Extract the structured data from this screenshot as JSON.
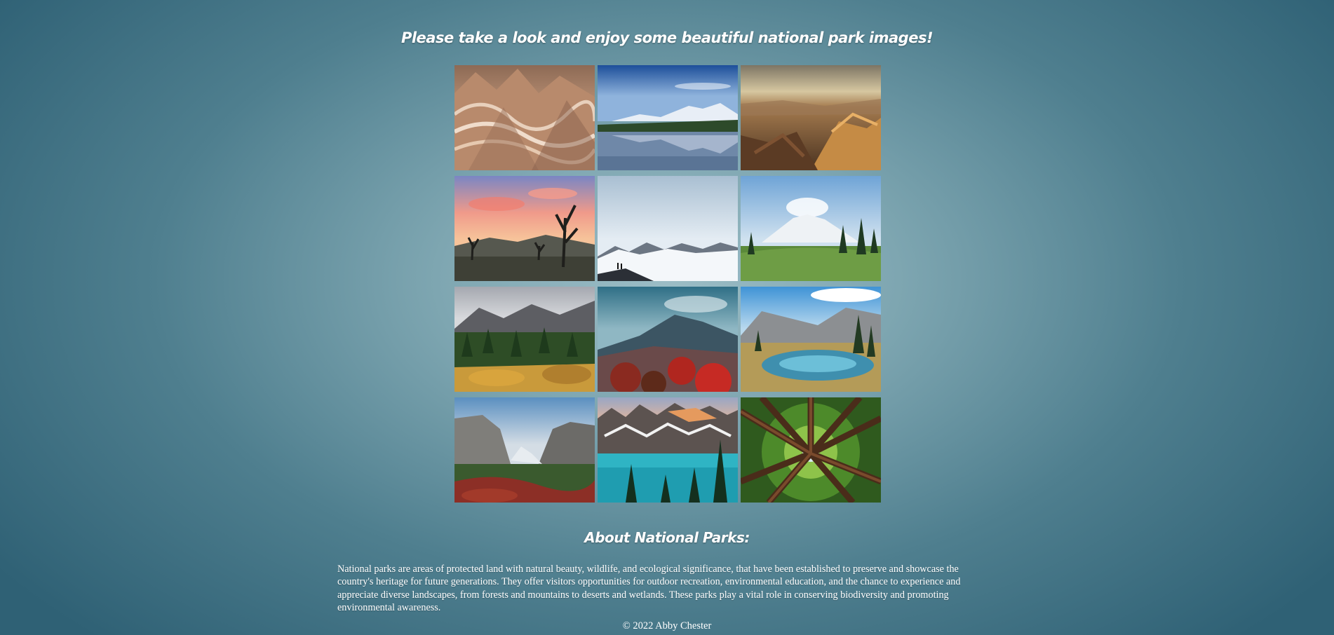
{
  "page": {
    "heading": "Please take a look and enjoy some beautiful national park images!",
    "about_title": "About National Parks:",
    "about_text": "National parks are areas of protected land with natural beauty, wildlife, and ecological significance, that have been established to preserve and showcase the country's heritage for future generations. They offer visitors opportunities for outdoor recreation, environmental education, and the chance to experience and appreciate diverse landscapes, from forests and mountains to deserts and wetlands. These parks play a vital role in conserving biodiversity and promoting environmental awareness.",
    "footer": "© 2022 Abby Chester"
  },
  "colors": {
    "background_center": "#9cbdc6",
    "background_edge": "#2f6175",
    "text": "#ffffff"
  },
  "gallery": {
    "images": [
      {
        "icon": "badlands-photo"
      },
      {
        "icon": "mountain-lake-photo"
      },
      {
        "icon": "grand-canyon-photo"
      },
      {
        "icon": "joshua-tree-photo"
      },
      {
        "icon": "snowfield-photo"
      },
      {
        "icon": "mount-rainier-photo"
      },
      {
        "icon": "autumn-valley-photo"
      },
      {
        "icon": "red-foliage-mountain-photo"
      },
      {
        "icon": "alpine-pond-photo"
      },
      {
        "icon": "yosemite-valley-photo"
      },
      {
        "icon": "moraine-lake-photo"
      },
      {
        "icon": "redwood-canopy-photo"
      }
    ]
  }
}
